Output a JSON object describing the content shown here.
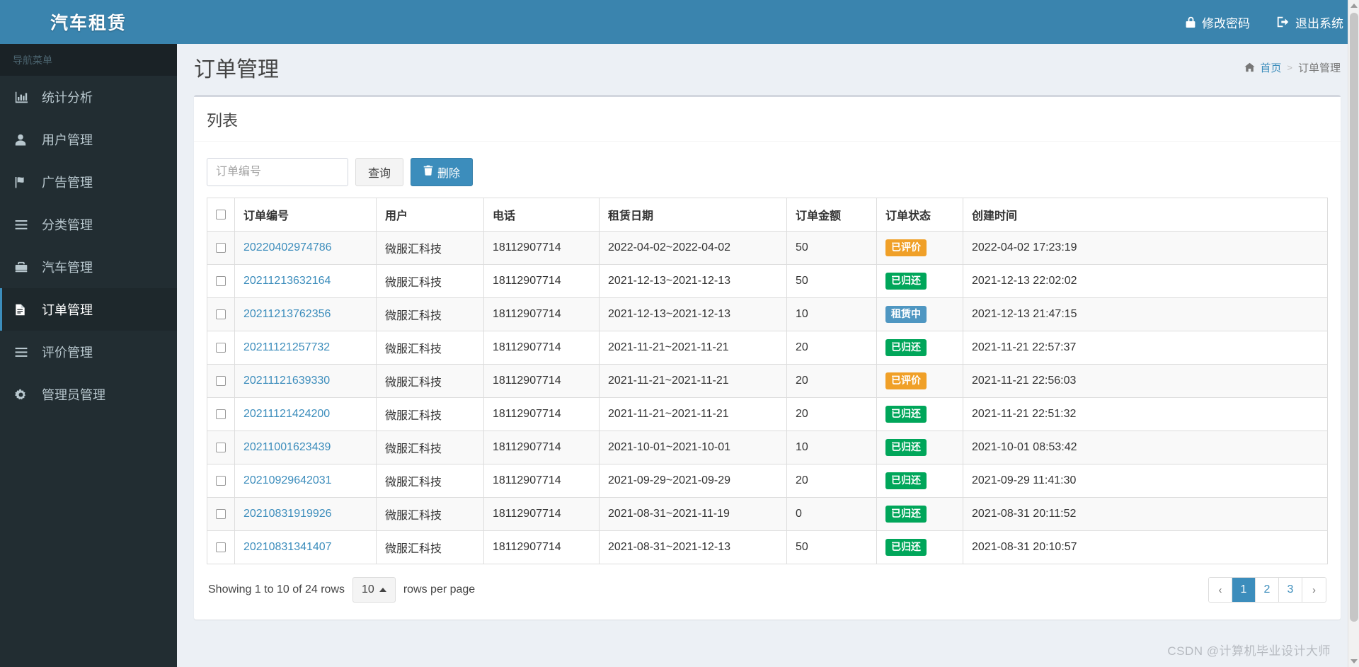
{
  "brand": {
    "title": "汽车租赁"
  },
  "sidebar": {
    "nav_header": "导航菜单",
    "items": [
      {
        "label": "统计分析",
        "icon": "bar-chart-icon",
        "key": "statistics",
        "active": false
      },
      {
        "label": "用户管理",
        "icon": "user-icon",
        "key": "users",
        "active": false
      },
      {
        "label": "广告管理",
        "icon": "flag-icon",
        "key": "ads",
        "active": false
      },
      {
        "label": "分类管理",
        "icon": "list-icon",
        "key": "categories",
        "active": false
      },
      {
        "label": "汽车管理",
        "icon": "briefcase-icon",
        "key": "cars",
        "active": false
      },
      {
        "label": "订单管理",
        "icon": "file-icon",
        "key": "orders",
        "active": true
      },
      {
        "label": "评价管理",
        "icon": "list-icon",
        "key": "reviews",
        "active": false
      },
      {
        "label": "管理员管理",
        "icon": "gear-icon",
        "key": "admins",
        "active": false
      }
    ]
  },
  "topbar": {
    "change_password": "修改密码",
    "logout": "退出系统"
  },
  "header": {
    "page_title": "订单管理",
    "breadcrumb": {
      "home": "首页",
      "separator": ">",
      "current": "订单管理"
    }
  },
  "box": {
    "title": "列表",
    "search": {
      "placeholder": "订单编号",
      "value": ""
    },
    "query_button": "查询",
    "delete_button": "删除"
  },
  "table": {
    "columns": [
      "订单编号",
      "用户",
      "电话",
      "租赁日期",
      "订单金额",
      "订单状态",
      "创建时间"
    ],
    "rows": [
      {
        "order_no": "20220402974786",
        "user": "微服汇科技",
        "phone": "18112907714",
        "rent_date": "2022-04-02~2022-04-02",
        "amount": "50",
        "status": "已评价",
        "status_type": "warning",
        "created": "2022-04-02 17:23:19"
      },
      {
        "order_no": "20211213632164",
        "user": "微服汇科技",
        "phone": "18112907714",
        "rent_date": "2021-12-13~2021-12-13",
        "amount": "50",
        "status": "已归还",
        "status_type": "success",
        "created": "2021-12-13 22:02:02"
      },
      {
        "order_no": "20211213762356",
        "user": "微服汇科技",
        "phone": "18112907714",
        "rent_date": "2021-12-13~2021-12-13",
        "amount": "10",
        "status": "租赁中",
        "status_type": "info",
        "created": "2021-12-13 21:47:15"
      },
      {
        "order_no": "20211121257732",
        "user": "微服汇科技",
        "phone": "18112907714",
        "rent_date": "2021-11-21~2021-11-21",
        "amount": "20",
        "status": "已归还",
        "status_type": "success",
        "created": "2021-11-21 22:57:37"
      },
      {
        "order_no": "20211121639330",
        "user": "微服汇科技",
        "phone": "18112907714",
        "rent_date": "2021-11-21~2021-11-21",
        "amount": "20",
        "status": "已评价",
        "status_type": "warning",
        "created": "2021-11-21 22:56:03"
      },
      {
        "order_no": "20211121424200",
        "user": "微服汇科技",
        "phone": "18112907714",
        "rent_date": "2021-11-21~2021-11-21",
        "amount": "20",
        "status": "已归还",
        "status_type": "success",
        "created": "2021-11-21 22:51:32"
      },
      {
        "order_no": "20211001623439",
        "user": "微服汇科技",
        "phone": "18112907714",
        "rent_date": "2021-10-01~2021-10-01",
        "amount": "10",
        "status": "已归还",
        "status_type": "success",
        "created": "2021-10-01 08:53:42"
      },
      {
        "order_no": "20210929642031",
        "user": "微服汇科技",
        "phone": "18112907714",
        "rent_date": "2021-09-29~2021-09-29",
        "amount": "20",
        "status": "已归还",
        "status_type": "success",
        "created": "2021-09-29 11:41:30"
      },
      {
        "order_no": "20210831919926",
        "user": "微服汇科技",
        "phone": "18112907714",
        "rent_date": "2021-08-31~2021-11-19",
        "amount": "0",
        "status": "已归还",
        "status_type": "success",
        "created": "2021-08-31 20:11:52"
      },
      {
        "order_no": "20210831341407",
        "user": "微服汇科技",
        "phone": "18112907714",
        "rent_date": "2021-08-31~2021-12-13",
        "amount": "50",
        "status": "已归还",
        "status_type": "success",
        "created": "2021-08-31 20:10:57"
      }
    ]
  },
  "footer": {
    "showing_text": "Showing 1 to 10 of 24 rows",
    "rows_per_page_value": "10",
    "rows_per_page_label": "rows per page",
    "pages": [
      {
        "label": "‹",
        "type": "prev",
        "active": false
      },
      {
        "label": "1",
        "type": "page",
        "active": true
      },
      {
        "label": "2",
        "type": "page",
        "active": false
      },
      {
        "label": "3",
        "type": "page",
        "active": false
      },
      {
        "label": "›",
        "type": "next",
        "active": false
      }
    ]
  },
  "watermark": "CSDN @计算机毕业设计大师",
  "colors": {
    "header_blue": "#3a84ae",
    "sidebar_dark": "#1a2226",
    "nav_bg": "#222d32",
    "accent": "#3c8dbc",
    "badge_warning": "#f0a028",
    "badge_success": "#00a65a",
    "badge_info": "#4f97c2"
  }
}
